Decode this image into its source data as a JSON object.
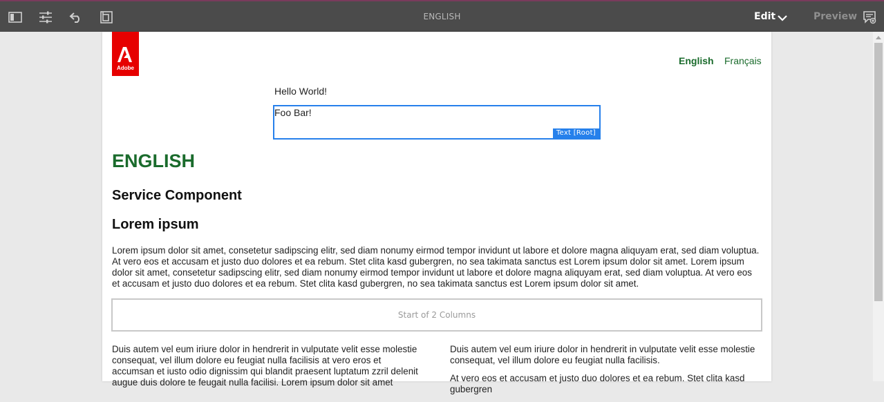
{
  "toolbar": {
    "title": "ENGLISH",
    "mode_label": "Edit",
    "preview_label": "Preview",
    "icons": [
      "side-panel-icon",
      "properties-icon",
      "undo-icon",
      "page-info-icon",
      "annotations-icon"
    ]
  },
  "page": {
    "logo_text": "Adobe",
    "languages": [
      "English",
      "Français"
    ],
    "hello_text": "Hello World!",
    "text_component": {
      "value": "Foo Bar!",
      "badge": "Text [Root]"
    },
    "heading_main": "ENGLISH",
    "heading_service": "Service Component",
    "heading_lorem": "Lorem ipsum",
    "paragraph": "Lorem ipsum dolor sit amet, consetetur sadipscing elitr, sed diam nonumy eirmod tempor invidunt ut labore et dolore magna aliquyam erat, sed diam voluptua. At vero eos et accusam et justo duo dolores et ea rebum. Stet clita kasd gubergren, no sea takimata sanctus est Lorem ipsum dolor sit amet. Lorem ipsum dolor sit amet, consetetur sadipscing elitr, sed diam nonumy eirmod tempor invidunt ut labore et dolore magna aliquyam erat, sed diam voluptua. At vero eos et accusam et justo duo dolores et ea rebum. Stet clita kasd gubergren, no sea takimata sanctus est Lorem ipsum dolor sit amet.",
    "columns_placeholder": "Start of 2 Columns",
    "column_left": [
      "Duis autem vel eum iriure dolor in hendrerit in vulputate velit esse molestie consequat, vel illum dolore eu feugiat nulla facilisis at vero eros et accumsan et iusto odio dignissim qui blandit praesent luptatum zzril delenit augue duis dolore te feugait nulla facilisi. Lorem ipsum dolor sit amet"
    ],
    "column_right": [
      "Duis autem vel eum iriure dolor in hendrerit in vulputate velit esse molestie consequat, vel illum dolore eu feugiat nulla facilisis.",
      "At vero eos et accusam et justo duo dolores et ea rebum. Stet clita kasd gubergren"
    ]
  },
  "colors": {
    "accent_blue": "#2680eb",
    "brand_red": "#e60000",
    "heading_green": "#1a6b2c",
    "toolbar_bg": "#4b4b4b"
  }
}
